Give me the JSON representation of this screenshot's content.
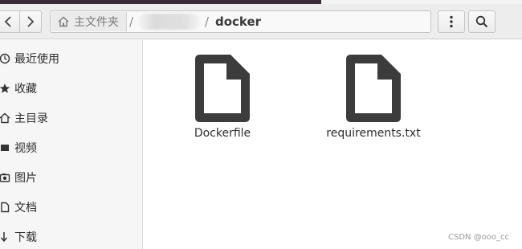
{
  "header": {
    "path": {
      "home_label": "主文件夹",
      "separator": "/",
      "current_label": "docker"
    }
  },
  "sidebar": {
    "items": [
      {
        "label": "最近使用",
        "icon": "clock-icon"
      },
      {
        "label": "收藏",
        "icon": "star-icon"
      },
      {
        "label": "主目录",
        "icon": "home-icon"
      },
      {
        "label": "视频",
        "icon": "video-icon"
      },
      {
        "label": "图片",
        "icon": "camera-icon"
      },
      {
        "label": "文档",
        "icon": "document-icon"
      },
      {
        "label": "下载",
        "icon": "download-icon"
      }
    ]
  },
  "files": [
    {
      "name": "Dockerfile",
      "icon": "text-file-icon"
    },
    {
      "name": "requirements.txt",
      "icon": "text-file-icon"
    }
  ],
  "watermark": "CSDN @ooo_cc",
  "colors": {
    "file_icon": "#3c3c3c",
    "sidebar_bg": "#f6f6f6",
    "toolbar_bg": "#ededed"
  }
}
